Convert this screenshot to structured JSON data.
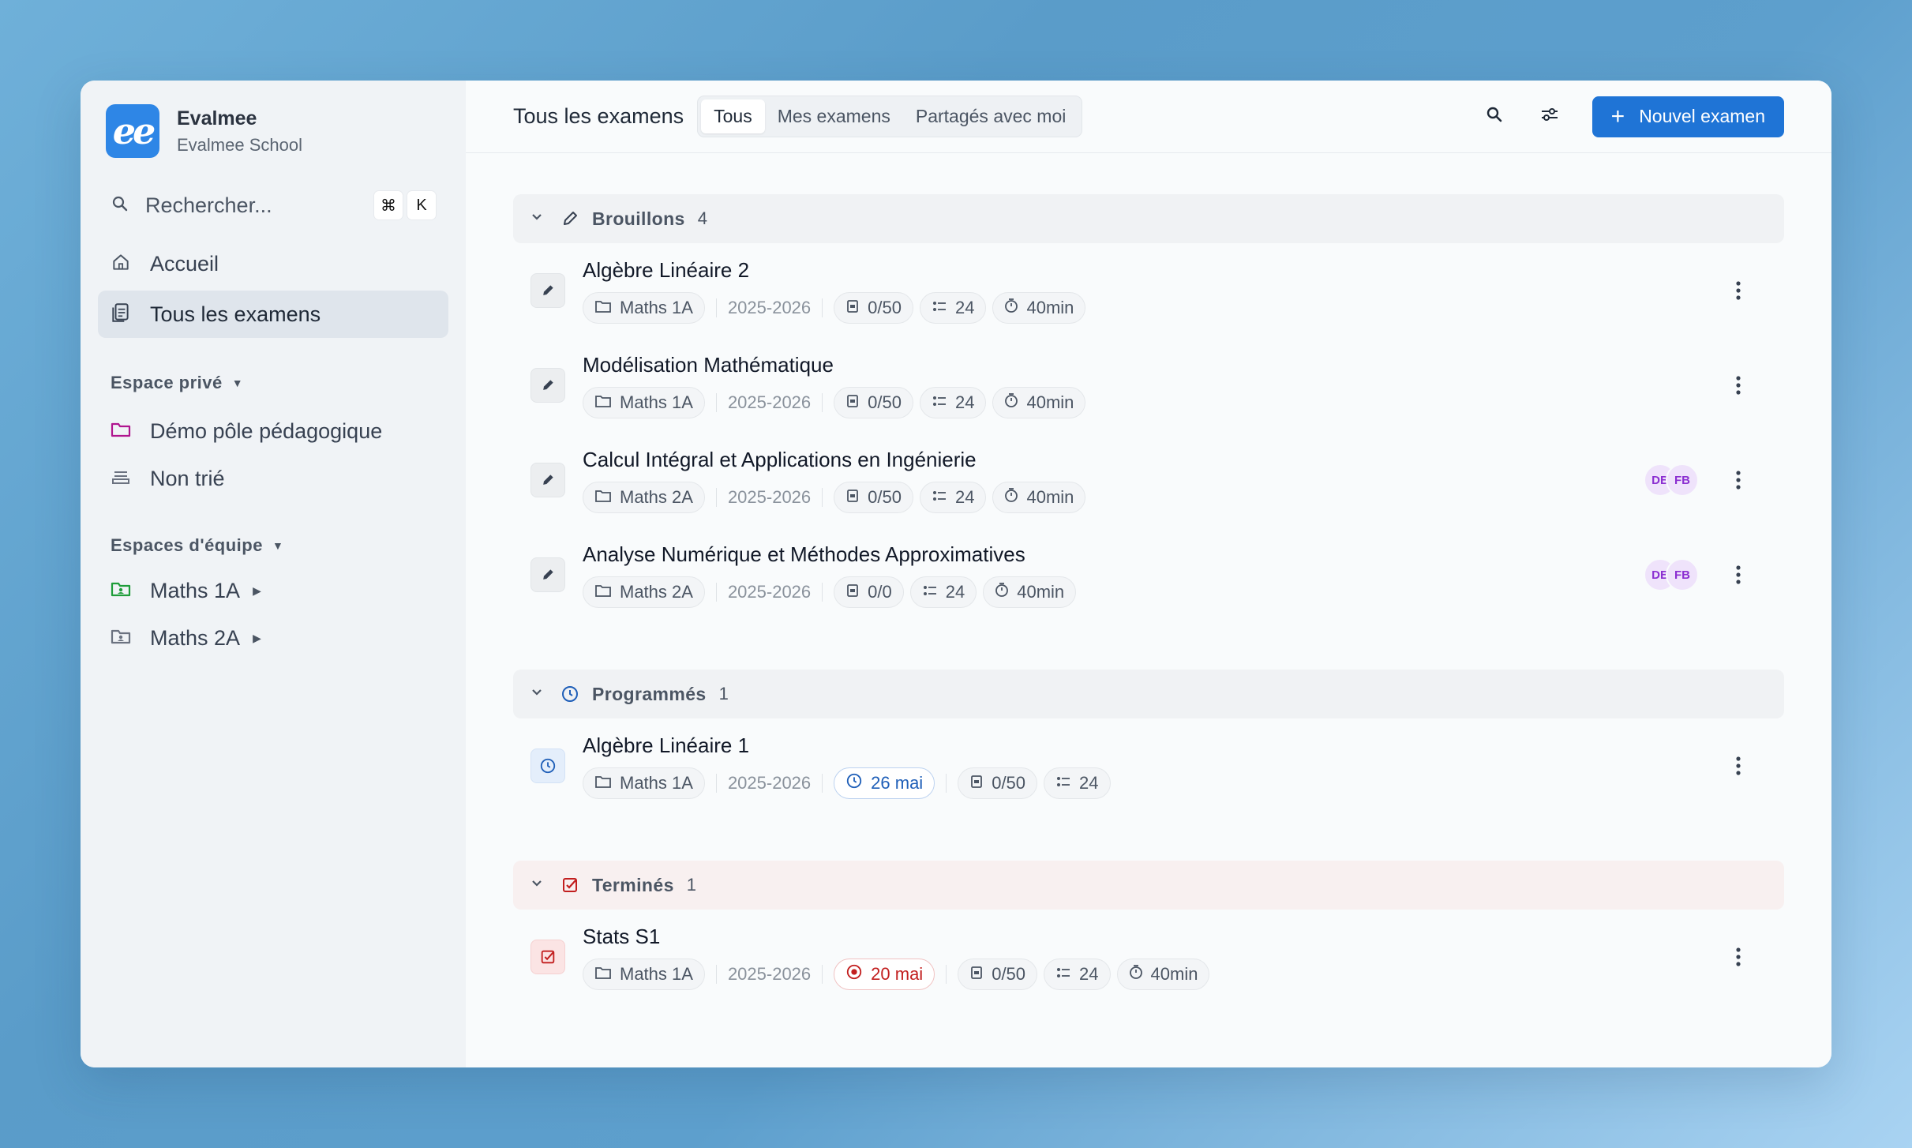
{
  "brand": {
    "name": "Evalmee",
    "school": "Evalmee School",
    "logo_text": "ee"
  },
  "sidebar": {
    "search_label": "Rechercher...",
    "shortcut": [
      "⌘",
      "K"
    ],
    "nav": [
      {
        "label": "Accueil",
        "icon": "home-icon"
      },
      {
        "label": "Tous les examens",
        "icon": "document-icon",
        "active": true
      }
    ],
    "private_space": {
      "title": "Espace privé",
      "items": [
        {
          "label": "Démo pôle pédagogique",
          "icon": "folder-icon",
          "color": "#b0158f"
        },
        {
          "label": "Non trié",
          "icon": "inbox-icon",
          "color": "#6b7280"
        }
      ]
    },
    "team_space": {
      "title": "Espaces d'équipe",
      "items": [
        {
          "label": "Maths 1A",
          "icon": "shared-folder-icon",
          "color": "#1f9d3a"
        },
        {
          "label": "Maths 2A",
          "icon": "shared-folder-icon",
          "color": "#6b7280"
        }
      ]
    }
  },
  "header": {
    "title": "Tous les examens",
    "tabs": [
      "Tous",
      "Mes examens",
      "Partagés avec moi"
    ],
    "active_tab": "Tous",
    "new_button": "Nouvel examen"
  },
  "groups": [
    {
      "label": "Brouillons",
      "count": "4",
      "icon": "pencil-icon",
      "exams": [
        {
          "name": "Algèbre Linéaire 2",
          "folder": "Maths 1A",
          "year": "2025-2026",
          "score": "0/50",
          "questions": "24",
          "duration": "40min",
          "avatars": []
        },
        {
          "name": "Modélisation Mathématique",
          "folder": "Maths 1A",
          "year": "2025-2026",
          "score": "0/50",
          "questions": "24",
          "duration": "40min",
          "avatars": []
        },
        {
          "name": "Calcul Intégral et Applications en Ingénierie",
          "folder": "Maths 2A",
          "year": "2025-2026",
          "score": "0/50",
          "questions": "24",
          "duration": "40min",
          "avatars": [
            "DB",
            "FB"
          ]
        },
        {
          "name": "Analyse Numérique et Méthodes Approximatives",
          "folder": "Maths 2A",
          "year": "2025-2026",
          "score": "0/0",
          "questions": "24",
          "duration": "40min",
          "avatars": [
            "DB",
            "FB"
          ]
        }
      ]
    },
    {
      "label": "Programmés",
      "count": "1",
      "icon": "clock-icon",
      "exams": [
        {
          "name": "Algèbre Linéaire 1",
          "folder": "Maths 1A",
          "year": "2025-2026",
          "date": "26 mai",
          "score": "0/50",
          "questions": "24"
        }
      ]
    },
    {
      "label": "Terminés",
      "count": "1",
      "icon": "checkbox-icon",
      "exams": [
        {
          "name": "Stats S1",
          "folder": "Maths 1A",
          "year": "2025-2026",
          "date": "20 mai",
          "score": "0/50",
          "questions": "24",
          "duration": "40min"
        }
      ]
    }
  ]
}
